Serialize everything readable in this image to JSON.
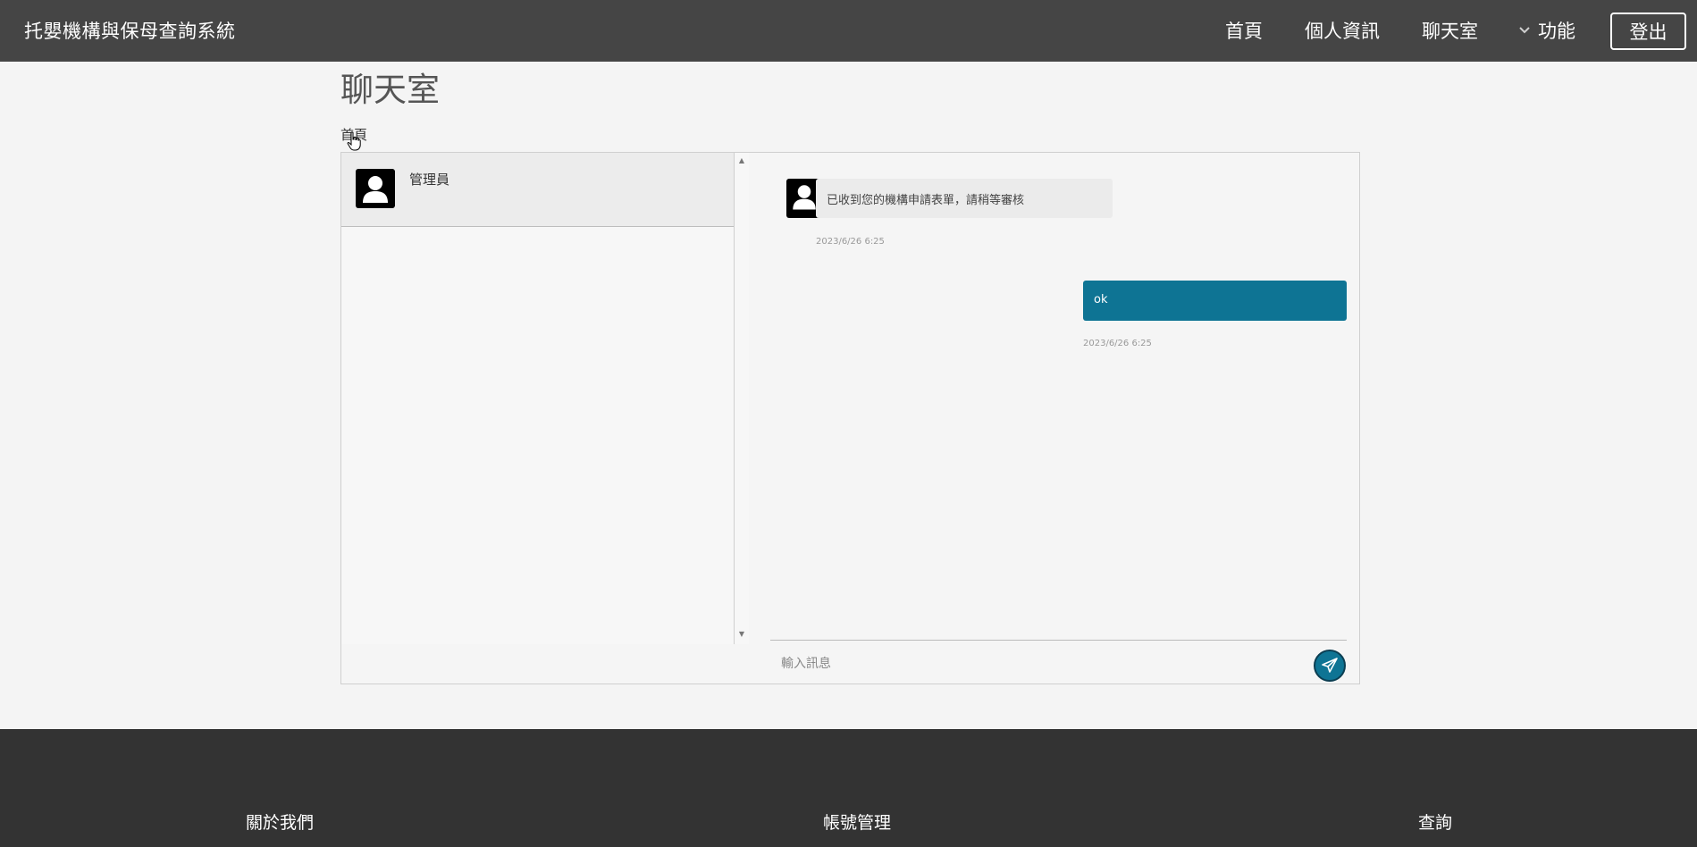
{
  "navbar": {
    "brand": "托嬰機構與保母查詢系統",
    "links": {
      "home": "首頁",
      "profile": "個人資訊",
      "chat": "聊天室",
      "functions": "功能"
    },
    "logout": "登出"
  },
  "page": {
    "title": "聊天室",
    "breadcrumb": "首頁"
  },
  "contacts": [
    {
      "name": "管理員",
      "selected": true
    }
  ],
  "messages": [
    {
      "direction": "incoming",
      "text": "已收到您的機構申請表單，請稍等審核",
      "time": "2023/6/26 6:25"
    },
    {
      "direction": "outgoing",
      "text": "ok",
      "time": "2023/6/26 6:25"
    }
  ],
  "compose": {
    "placeholder": "輸入訊息",
    "value": ""
  },
  "footer": {
    "about": "關於我們",
    "account": "帳號管理",
    "search": "查詢"
  },
  "colors": {
    "navbar": "#454545",
    "accent": "#0e7494",
    "footer": "#333333"
  },
  "icons": {
    "avatar": "user-silhouette-icon",
    "send": "paper-plane-icon",
    "dropdown": "chevron-down-icon",
    "cursor": "hand-pointer-icon"
  }
}
